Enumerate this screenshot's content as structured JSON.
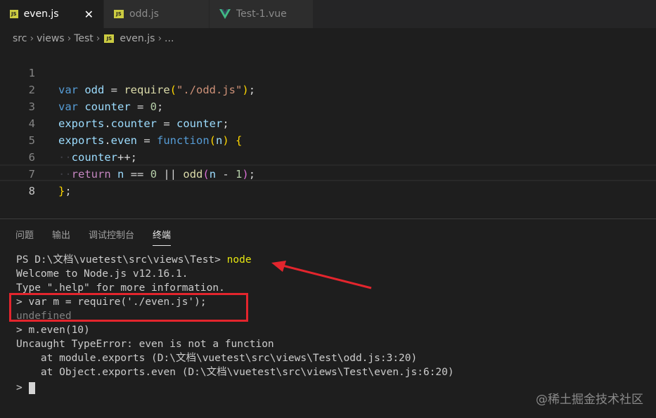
{
  "tabs": [
    {
      "label": "even.js",
      "icon": "js-file-icon",
      "active": true,
      "close": "✕"
    },
    {
      "label": "odd.js",
      "icon": "js-file-icon",
      "active": false
    },
    {
      "label": "Test-1.vue",
      "icon": "vue-file-icon",
      "active": false
    }
  ],
  "icon_badge": "JS",
  "breadcrumb": [
    "src",
    "views",
    "Test",
    "even.js",
    "..."
  ],
  "editor": {
    "line_numbers": [
      "1",
      "2",
      "3",
      "4",
      "5",
      "6",
      "7",
      "8"
    ],
    "lines": [
      "var odd = require(\"./odd.js\");",
      "var counter = 0;",
      "exports.counter = counter;",
      "exports.even = function(n) {",
      "  counter++;",
      "  return n == 0 || odd(n - 1);",
      "};",
      ""
    ]
  },
  "panel": {
    "tabs": [
      "问题",
      "输出",
      "调试控制台",
      "终端"
    ],
    "active_tab": "终端"
  },
  "terminal": {
    "prompt": "PS D:\\文档\\vuetest\\src\\views\\Test> ",
    "command": "node",
    "lines": [
      "Welcome to Node.js v12.16.1.",
      "Type \".help\" for more information.",
      "> var m = require('./even.js');",
      "undefined",
      "> m.even(10)",
      "Uncaught TypeError: even is not a function",
      "    at module.exports (D:\\文档\\vuetest\\src\\views\\Test\\odd.js:3:20)",
      "    at Object.exports.even (D:\\文档\\vuetest\\src\\views\\Test\\even.js:6:20)"
    ],
    "final_prompt": ">"
  },
  "watermark": "@稀土掘金技术社区",
  "colors": {
    "annotation_red": "#e3252d",
    "js_icon": "#cbcb41",
    "vue_icon": "#41b883"
  }
}
